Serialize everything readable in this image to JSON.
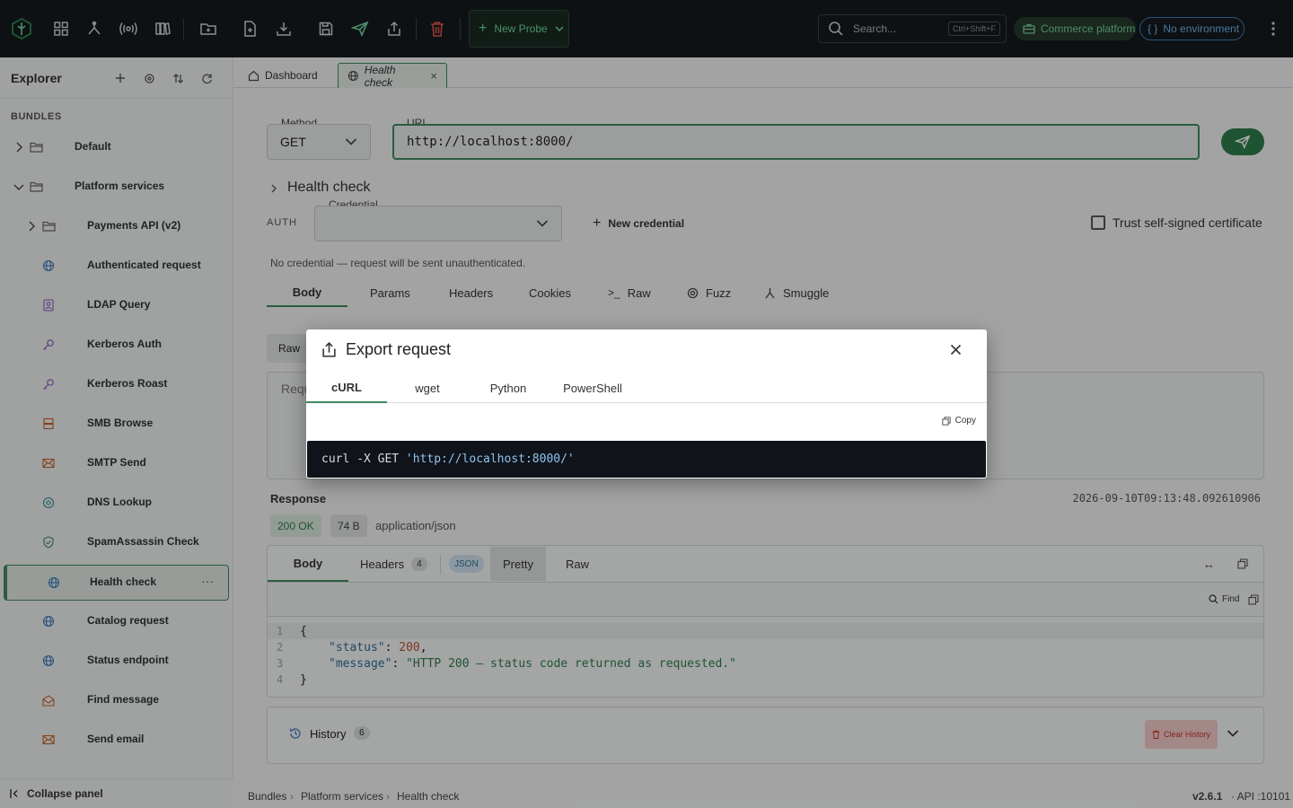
{
  "toolbar": {
    "new_probe_label": "New Probe",
    "search_placeholder": "Search...",
    "search_shortcut": "Ctrl+Shift+F",
    "workspace_label": "Commerce platform",
    "environment_label": "No environment"
  },
  "sidebar": {
    "title": "Explorer",
    "section_label": "BUNDLES",
    "items": [
      {
        "label": "Default",
        "icon": "folder-icon"
      },
      {
        "label": "Platform services",
        "icon": "folder-icon"
      },
      {
        "label": "Payments API (v2)",
        "icon": "folder-icon"
      },
      {
        "label": "Authenticated request",
        "icon": "globe-icon"
      },
      {
        "label": "LDAP Query",
        "icon": "ldap-icon"
      },
      {
        "label": "Kerberos Auth",
        "icon": "key-icon"
      },
      {
        "label": "Kerberos Roast",
        "icon": "key-icon"
      },
      {
        "label": "SMB Browse",
        "icon": "server-icon"
      },
      {
        "label": "SMTP Send",
        "icon": "mail-icon"
      },
      {
        "label": "DNS Lookup",
        "icon": "dns-icon"
      },
      {
        "label": "SpamAssassin Check",
        "icon": "shield-icon"
      },
      {
        "label": "Health check",
        "icon": "globe-icon"
      },
      {
        "label": "Catalog request",
        "icon": "globe-icon"
      },
      {
        "label": "Status endpoint",
        "icon": "globe-icon"
      },
      {
        "label": "Find message",
        "icon": "mail-open-icon"
      },
      {
        "label": "Send email",
        "icon": "mail-icon"
      }
    ],
    "collapse_label": "Collapse panel"
  },
  "tabs": [
    {
      "label": "Dashboard"
    },
    {
      "label": "Health check"
    }
  ],
  "request": {
    "method_label": "Method",
    "method": "GET",
    "url_label": "URL",
    "url": "http://localhost:8000/",
    "title": "Health check",
    "auth_label": "AUTH",
    "credential_label": "Credential",
    "new_credential_label": "New credential",
    "trust_label": "Trust self-signed certificate",
    "no_credential_note": "No credential — request will be sent unauthenticated.",
    "tabs": [
      "Body",
      "Params",
      "Headers",
      "Cookies",
      "Raw",
      "Fuzz",
      "Smuggle"
    ],
    "body_mode": "Raw",
    "body_placeholder": "Requ"
  },
  "response": {
    "title": "Response",
    "timestamp": "2026-09-10T09:13:48.092610906",
    "status": "200 OK",
    "size": "74 B",
    "content_type": "application/json",
    "tabs": {
      "body": "Body",
      "headers": "Headers",
      "headers_count": "4",
      "json_badge": "JSON",
      "pretty": "Pretty",
      "raw": "Raw"
    },
    "find_label": "Find",
    "code": [
      {
        "num": "1",
        "text": "{"
      },
      {
        "num": "2",
        "key": "\"status\"",
        "value": "200",
        "trail": ","
      },
      {
        "num": "3",
        "key": "\"message\"",
        "value": "\"HTTP 200 — status code returned as requested.\"",
        "trail": ""
      },
      {
        "num": "4",
        "text": "}"
      }
    ]
  },
  "history": {
    "label": "History",
    "count": "6",
    "clear_label": "Clear History"
  },
  "breadcrumb": [
    "Bundles",
    "Platform services",
    "Health check"
  ],
  "version": "v2.6.1",
  "api": "· API :10101",
  "modal": {
    "title": "Export request",
    "tabs": [
      "cURL",
      "wget",
      "Python",
      "PowerShell"
    ],
    "copy_label": "Copy",
    "code_prefix": "curl -X GET ",
    "code_url": "'http://localhost:8000/'"
  },
  "colors": {
    "accent": "#3f8a5e",
    "topbar": "#141a1c",
    "danger": "#c0392b",
    "env_blue": "#3f7ab5"
  }
}
